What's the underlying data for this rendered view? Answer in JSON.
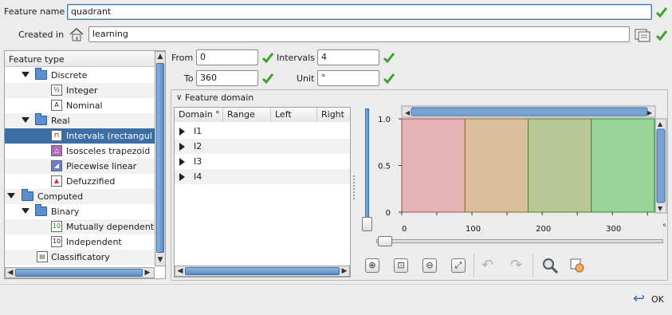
{
  "form": {
    "feature_name_label": "Feature name",
    "feature_name_value": "quadrant",
    "created_in_label": "Created in",
    "created_in_value": "learning"
  },
  "tree": {
    "header": "Feature type",
    "items": [
      {
        "label": "Discrete",
        "icon": "folder-icon"
      },
      {
        "label": "Integer",
        "icon": "integer-icon"
      },
      {
        "label": "Nominal",
        "icon": "nominal-icon"
      },
      {
        "label": "Real",
        "icon": "folder-icon"
      },
      {
        "label": "Intervals (rectangul",
        "icon": "intervals-icon"
      },
      {
        "label": "Isosceles trapezoid",
        "icon": "trapezoid-icon"
      },
      {
        "label": "Piecewise linear",
        "icon": "piecewise-icon"
      },
      {
        "label": "Defuzzified",
        "icon": "defuzzified-icon"
      },
      {
        "label": "Computed",
        "icon": "folder-icon"
      },
      {
        "label": "Binary",
        "icon": "folder-icon"
      },
      {
        "label": "Mutually dependent",
        "icon": "mutual-icon"
      },
      {
        "label": "Independent",
        "icon": "independent-icon"
      },
      {
        "label": "Classificatory",
        "icon": "classificatory-icon"
      }
    ]
  },
  "params": {
    "from_label": "From",
    "from_value": "0",
    "to_label": "To",
    "to_value": "360",
    "intervals_label": "Intervals",
    "intervals_value": "4",
    "unit_label": "Unit",
    "unit_value": "°"
  },
  "domain": {
    "section_title": "Feature domain",
    "columns": [
      "Domain °",
      "Range",
      "Left",
      "Right"
    ],
    "rows": [
      "I1",
      "I2",
      "I3",
      "I4"
    ]
  },
  "chart": {
    "y_ticks": [
      "1.0",
      "0.5",
      "0"
    ],
    "x_ticks": [
      "0",
      "100",
      "200",
      "300"
    ],
    "x_unit": "°",
    "colors": [
      "#e6b4b4",
      "#d9bf9a",
      "#b8c995",
      "#98d49a"
    ],
    "borders": [
      "#a05050",
      "#8a6a2a",
      "#507a22",
      "#2c8a36"
    ]
  },
  "chart_data": {
    "type": "bar",
    "categories": [
      "I1",
      "I2",
      "I3",
      "I4"
    ],
    "x_ranges": [
      [
        0,
        90
      ],
      [
        90,
        180
      ],
      [
        180,
        270
      ],
      [
        270,
        360
      ]
    ],
    "values": [
      1,
      1,
      1,
      1
    ],
    "xlim": [
      0,
      360
    ],
    "ylim": [
      0,
      1
    ],
    "x_ticks": [
      0,
      100,
      200,
      300
    ],
    "y_ticks": [
      0,
      0.5,
      1.0
    ]
  },
  "footer": {
    "ok_label": "OK"
  }
}
